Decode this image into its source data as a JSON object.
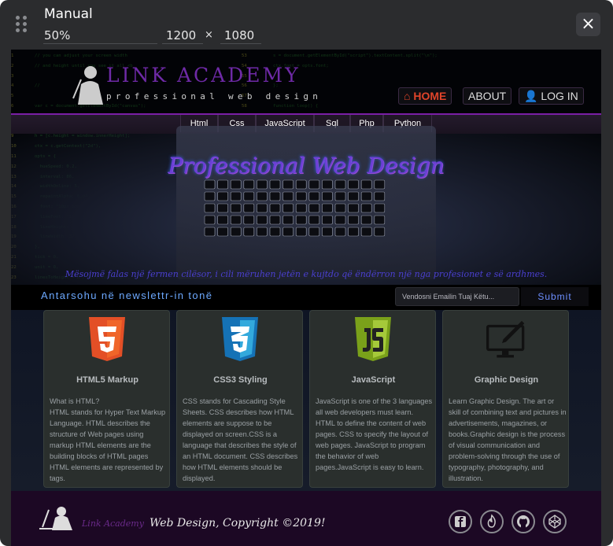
{
  "toolbar": {
    "device": "Manual",
    "zoom": "50%",
    "width": "1200",
    "times": "×",
    "height": "1080",
    "close": "×"
  },
  "site": {
    "brand": "LINK ACADEMY",
    "tagline": "professional web design",
    "nav": {
      "home": "HOME",
      "about": "ABOUT",
      "login": "LOG IN"
    },
    "menu": [
      "Html",
      "Css",
      "JavaScript",
      "Sql",
      "Php",
      "Python"
    ],
    "hero_title": "Professional Web Design",
    "hero_subtitle": "Mësojmë falas një fermen cilësor, i cili mëruhen jetën e kujtdo që ëndërron një nga profesionet e së ardhmes.",
    "newsletter": {
      "label": "Antarsohu në newslettr-in tonë",
      "placeholder": "Vendosni Emailin Tuaj Këtu...",
      "submit": "Submit"
    },
    "cards": [
      {
        "icon": "html5-icon",
        "title": "HTML5 Markup",
        "text": "What is HTML?\nHTML stands for Hyper Text Markup Language. HTML describes the structure of Web pages using markup HTML elements are the building blocks of HTML pages HTML elements are represented by tags."
      },
      {
        "icon": "css3-icon",
        "title": "CSS3 Styling",
        "text": "CSS stands for Cascading Style Sheets. CSS describes how HTML elements are suppose to be displayed on screen.CSS is a language that describes the style of an HTML document. CSS describes how HTML elements should be displayed."
      },
      {
        "icon": "javascript-icon",
        "title": "JavaScript",
        "text": "JavaScript is one of the 3 languages all web developers must learn. HTML to define the content of web pages. CSS to specify the layout of web pages. JavaScript to program the behavior of web pages.JavaScript is easy to learn."
      },
      {
        "icon": "graphic-design-icon",
        "title": "Graphic Design",
        "text": "Learn Graphic Design. The art or skill of combining text and pictures in advertisements, magazines, or books.Graphic design is the process of visual communication and problem-solving through the use of typography, photography, and illustration."
      }
    ],
    "footer": {
      "brand": "Link Academy",
      "copyright": "Web Design, Copyright ©2019!",
      "social": [
        "facebook-icon",
        "codepen-flame-icon",
        "github-icon",
        "codepen-icon"
      ]
    },
    "code_left": [
      "// you can adjust your screen width",
      "// and height until you see it all <b",
      "",
      "//",
      "",
      "var c = document.getElementById(\"canvas\");",
      "",
      "w = [c.width = window.innerWidth];",
      "h = [c.height = window.innerHeight];",
      "ctx = c.getContext(\"2d\"),",
      "opts = {",
      "  hueSpeed: 0.2,",
      "  interval: 86,",
      "  widthOnline: 5,",
      "  repaintAlpha: 0.04,",
      "  font: \"10px monospace\",",
      "  lineFont: \"10px monospace\",",
      "  lineHeight: 10, 3766",
      "  lineWidth: 377,",
      "},",
      "tick = 0,",
      "unit = 0,",
      "linesToHeight = h / opts.lineHeight,",
      "rainRows = [];",
      "",
      "fu"
    ],
    "code_left_nums": [
      "1",
      "2",
      "3",
      "4",
      "5",
      "6",
      "7",
      "8",
      "9",
      "10",
      "11",
      "12",
      "13",
      "14",
      "15",
      "16",
      "17",
      "18",
      "19",
      "20",
      "21",
      "22",
      "23",
      "24",
      "25",
      "26"
    ],
    "code_right": [
      "s = document.getElementById(\"script\").textContent.split(\"\\n\");",
      "ctx.font = opts.font;",
      "",
      "};",
      "",
      "function loop() {",
      "",
      "  window.requestAnimationFrame (loop);"
    ],
    "code_right_nums": [
      "53",
      "54",
      "55",
      "56",
      "57",
      "58",
      "59",
      "60"
    ]
  }
}
